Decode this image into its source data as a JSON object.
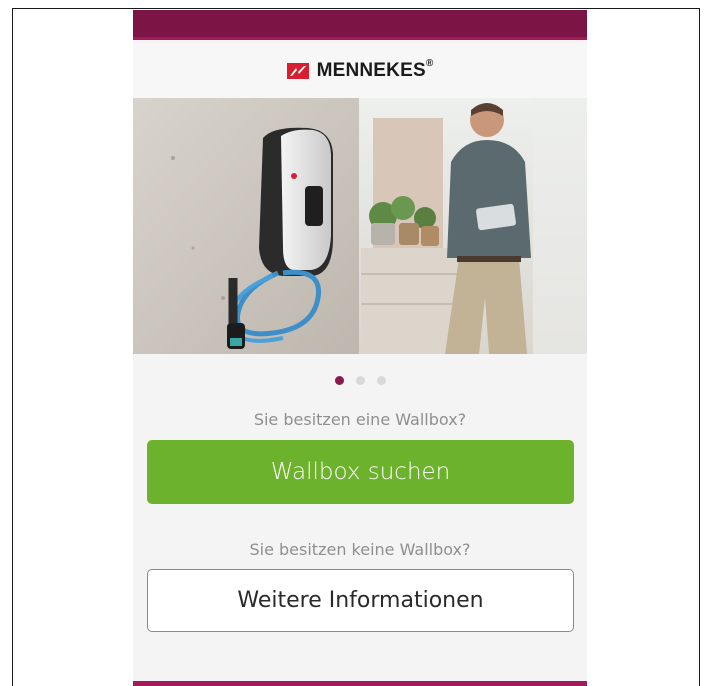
{
  "brand": {
    "name": "MENNEKES",
    "registered": "®",
    "logo_icon": "mennekes-logo-icon",
    "primary_color": "#7c1446",
    "accent_color": "#a2195c"
  },
  "hero": {
    "left_image": "wallbox-charger-photo",
    "right_image": "man-with-tablet-photo"
  },
  "carousel": {
    "total": 3,
    "active_index": 1
  },
  "owner_section": {
    "question": "Sie besitzen eine Wallbox?",
    "button_label": "Wallbox suchen",
    "button_color": "#6db22d"
  },
  "non_owner_section": {
    "question": "Sie besitzen keine Wallbox?",
    "button_label": "Weitere Informationen"
  }
}
